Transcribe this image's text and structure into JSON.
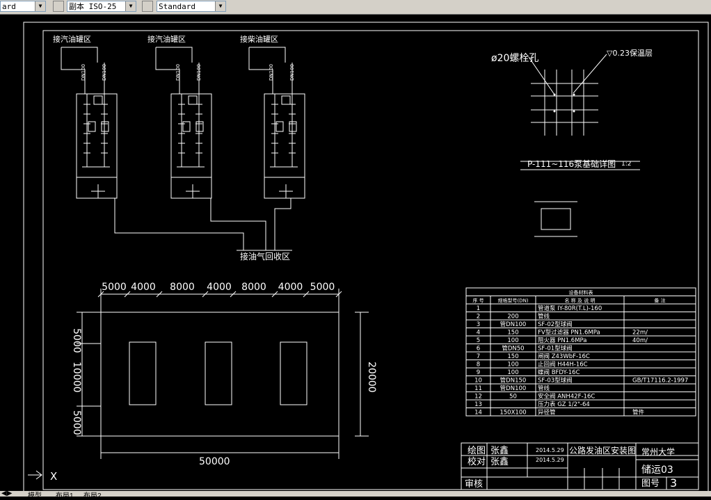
{
  "toolbar": {
    "text_style_value": "ard",
    "dim_style_value": "副本 ISO-25",
    "table_style_value": "Standard"
  },
  "drawing": {
    "pump_labels": [
      "接汽油罐区",
      "接汽油罐区",
      "接柴油罐区"
    ],
    "pipe_size_labels": [
      "DN100",
      "DN100",
      "DN100",
      "DN100",
      "DN100",
      "DN100"
    ],
    "vapor_recovery_label": "接油气回收区",
    "bolt_hole_label": "ø20螺栓孔",
    "cover_label": "▽0.23保温层",
    "detail_title": "P-111~116泵基础详图",
    "detail_scale": "1:2",
    "top_dims": [
      "5000",
      "4000",
      "8000",
      "4000",
      "8000",
      "4000",
      "5000"
    ],
    "left_dims": [
      "5000",
      "10000",
      "5000"
    ],
    "right_dim": "20000",
    "bottom_dim": "50000"
  },
  "table": {
    "title": "设备材料表",
    "headers": [
      "序 号",
      "规格型号(DN)",
      "名 称 及 说 明",
      "备 注"
    ],
    "rows": [
      {
        "no": "1",
        "spec": "",
        "name": "管道泵 IY-80R(T.L)-160",
        "note": ""
      },
      {
        "no": "2",
        "spec": "200",
        "name": "管线",
        "note": ""
      },
      {
        "no": "3",
        "spec": "管DN100",
        "name": "SF-02型球阀",
        "note": ""
      },
      {
        "no": "4",
        "spec": "150",
        "name": "FV型过滤器 PN1.6MPa",
        "note": "22m/"
      },
      {
        "no": "5",
        "spec": "100",
        "name": "阻火器 PN1.6MPa",
        "note": "40m/"
      },
      {
        "no": "6",
        "spec": "管DN50",
        "name": "SF-01型球阀",
        "note": ""
      },
      {
        "no": "7",
        "spec": "150",
        "name": "闸阀 Z43WbF-16C",
        "note": ""
      },
      {
        "no": "8",
        "spec": "100",
        "name": "止回阀 H44H-16C",
        "note": ""
      },
      {
        "no": "9",
        "spec": "100",
        "name": "蝶阀 BFDY-16C",
        "note": ""
      },
      {
        "no": "10",
        "spec": "管DN150",
        "name": "SF-03型球阀",
        "note": "GB/T17116.2-1997"
      },
      {
        "no": "11",
        "spec": "管DN100",
        "name": "管线",
        "note": ""
      },
      {
        "no": "12",
        "spec": "50",
        "name": "安全阀 ANH42F-16C",
        "note": ""
      },
      {
        "no": "13",
        "spec": "",
        "name": "压力表 GZ 1/2\"-64",
        "note": ""
      },
      {
        "no": "14",
        "spec": "150X100",
        "name": "异径管",
        "note": "管件"
      }
    ]
  },
  "titleblock": {
    "drawn_label": "绘图",
    "drawn_name": "张鑫",
    "drawn_date": "2014.5.29",
    "check_label": "校对",
    "check_name": "张鑫",
    "check_date": "2014.5.29",
    "drawing_title": "公路发油区安装图",
    "school": "常州大学",
    "dwg_code": "储运03",
    "sheet_label": "图号",
    "sheet_no": "3",
    "review_label": "审核"
  },
  "ucs": {
    "x_label": "X"
  },
  "layout_tabs": [
    "模型",
    "布局1",
    "布局2"
  ]
}
